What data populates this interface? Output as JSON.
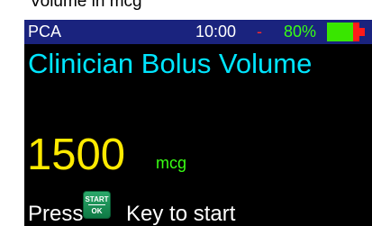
{
  "caption": "Volume in mcg",
  "status_bar": {
    "mode": "PCA",
    "time": "10:00",
    "separator": "-",
    "battery_percent": "80%",
    "battery_level": 0.8,
    "colors": {
      "bar_background": "#1a237e",
      "battery_percent_text": "#39ff14",
      "battery_fill": "#39e600",
      "battery_empty": "#ff1a1a",
      "separator": "#ff2a2a"
    },
    "battery_icon": "battery-icon"
  },
  "screen": {
    "title": "Clinician Bolus Volume",
    "value": "1500",
    "unit": "mcg",
    "colors": {
      "background": "#000000",
      "title": "#00e5ff",
      "value": "#ffea00",
      "unit": "#39ff14"
    }
  },
  "instruction": {
    "prefix": "Press",
    "suffix": "Key to start",
    "key_icon": "start-ok-key-icon",
    "key_label_top": "START",
    "key_label_bottom": "OK"
  }
}
